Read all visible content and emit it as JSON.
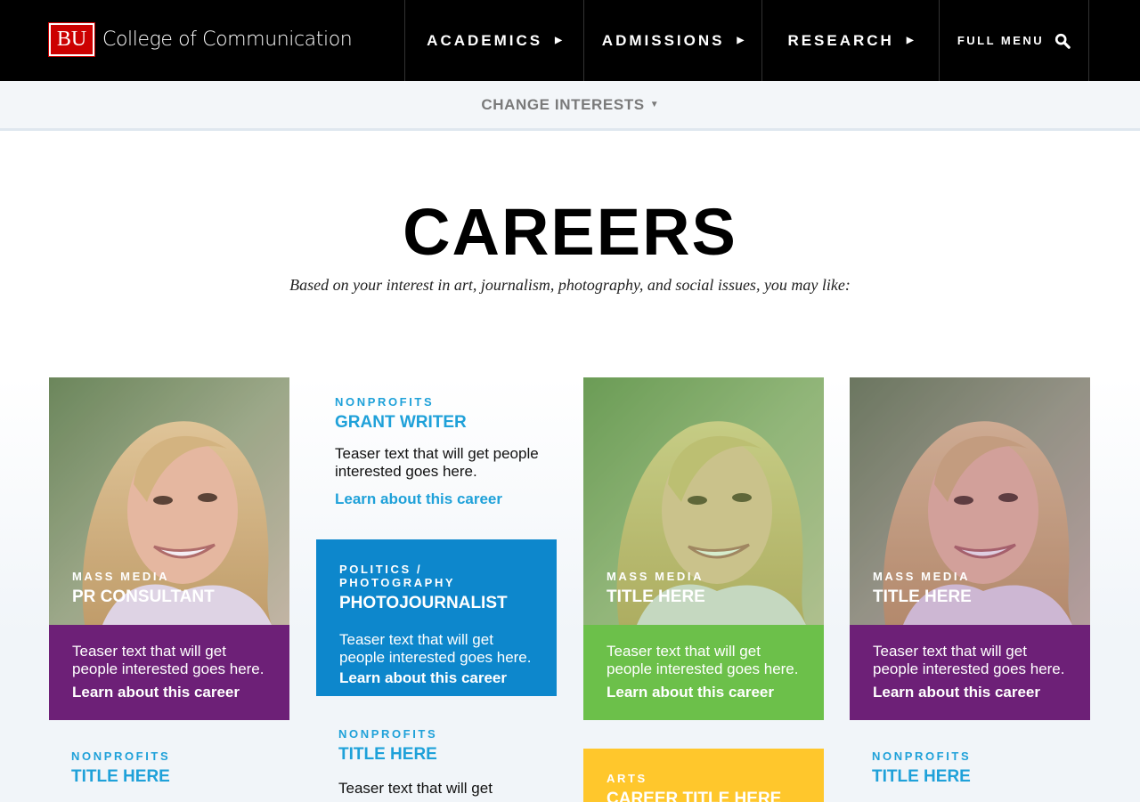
{
  "header": {
    "logo_text": "BU",
    "site_name": "College of Communication",
    "nav": [
      {
        "label": "ACADEMICS"
      },
      {
        "label": "ADMISSIONS"
      },
      {
        "label": "RESEARCH"
      }
    ],
    "full_menu_label": "FULL MENU"
  },
  "interests_bar": {
    "label": "CHANGE INTERESTS"
  },
  "hero": {
    "title": "CAREERS",
    "subtitle": "Based on your interest in art, journalism, photography, and social issues, you may like:"
  },
  "cards": {
    "pr": {
      "category": "MASS MEDIA",
      "title": "PR CONSULTANT",
      "teaser": "Teaser text that will get people interested goes here.",
      "link": "Learn about this career",
      "color": "#6d2077"
    },
    "grant": {
      "category": "NONPROFITS",
      "title": "GRANT WRITER",
      "teaser": "Teaser text that will get people interested goes here.",
      "link": "Learn about this career"
    },
    "photojournalist": {
      "category": "POLITICS / PHOTOGRAPHY",
      "title": "PHOTOJOURNALIST",
      "teaser": "Teaser text that will get people interested goes here.",
      "link": "Learn about this career",
      "color": "#0d87cc"
    },
    "green": {
      "category": "MASS MEDIA",
      "title": "TITLE HERE",
      "teaser": "Teaser text that will get people interested goes here.",
      "link": "Learn about this career",
      "color": "#6cc04a"
    },
    "purple2": {
      "category": "MASS MEDIA",
      "title": "TITLE HERE",
      "teaser": "Teaser text that will get people interested goes here.",
      "link": "Learn about this career",
      "color": "#6d2077"
    },
    "row2_col1": {
      "category": "NONPROFITS",
      "title": "TITLE HERE"
    },
    "row2_col2": {
      "category": "NONPROFITS",
      "title": "TITLE HERE",
      "teaser": "Teaser text that will get"
    },
    "row2_col3": {
      "category": "ARTS",
      "title": "CAREER TITLE HERE",
      "color": "#ffc72c"
    },
    "row2_col4": {
      "category": "NONPROFITS",
      "title": "TITLE HERE"
    }
  }
}
